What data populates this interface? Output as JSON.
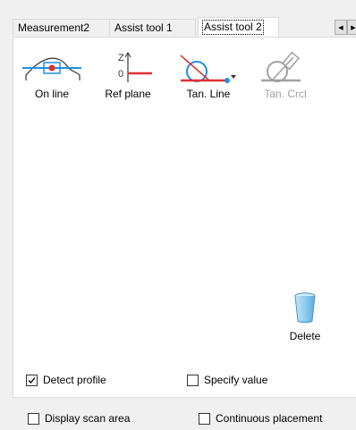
{
  "tabs": [
    {
      "label": "Measurement2"
    },
    {
      "label": "Assist tool 1"
    },
    {
      "label": "Assist tool 2"
    }
  ],
  "tools": [
    {
      "label": "On line",
      "icon": "on-line-icon",
      "enabled": true
    },
    {
      "label": "Ref plane",
      "icon": "ref-plane-icon",
      "enabled": true
    },
    {
      "label": "Tan. Line",
      "icon": "tangent-line-icon",
      "enabled": true
    },
    {
      "label": "Tan. Crcl",
      "icon": "tangent-circle-icon",
      "enabled": false
    }
  ],
  "ref_plane_axis": {
    "z": "Z",
    "zero": "0"
  },
  "delete": {
    "label": "Delete",
    "icon": "trash-can-icon"
  },
  "options": {
    "detect_profile": {
      "label": "Detect profile",
      "checked": true
    },
    "specify_value": {
      "label": "Specify value",
      "checked": false
    },
    "display_scan_area": {
      "label": "Display scan area",
      "checked": false
    },
    "continuous_placement": {
      "label": "Continuous placement",
      "checked": false
    }
  },
  "colors": {
    "accent_blue": "#1e8fe0",
    "accent_red": "#e03030",
    "disabled_gray": "#a0a0a0"
  }
}
